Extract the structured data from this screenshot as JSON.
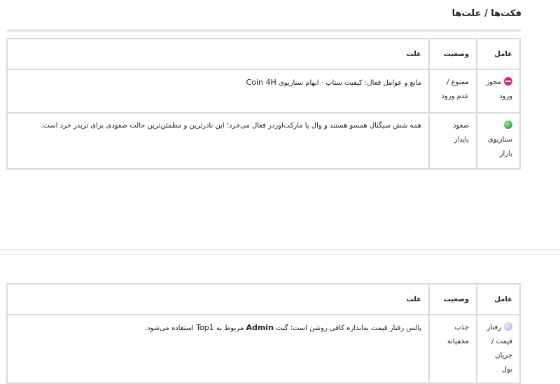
{
  "section": {
    "title": "فکت‌ها / علت‌ها"
  },
  "table1": {
    "headers": {
      "factor": "عامل",
      "status": "وضعیت",
      "reason": "علت"
    },
    "rows": [
      {
        "icon": "no-entry-icon",
        "factor": "مجوز ورود",
        "status": "ممنوع / عدم ورود",
        "reason_prefix": "مانع و عوامل فعال: کیفیت ستاپ · ابهام سناریوی",
        "reason_ltr": "Coin 4H"
      },
      {
        "icon": "green-circle-icon",
        "factor": "سناریوی بازار",
        "status": "صعود پایدار",
        "reason": "همه شش سیگنال همسو هستند و وال یا مارکت‌اوردر فعال می‌خرد؛ این نادرترین و مطمئن‌ترین حالت صعودی برای تریدر خرد است."
      }
    ]
  },
  "table2": {
    "headers": {
      "factor": "عامل",
      "status": "وضعیت",
      "reason": "علت"
    },
    "rows": [
      {
        "icon": "lavender-circle-icon",
        "factor": "رفتار قیمت / جریان پول",
        "status": "جذب مخفیانه",
        "reason_part1": "پالس رفتار قیمت به‌اندازه کافی روشن است؛ گیت",
        "reason_admin": "Admin",
        "reason_part2": "مربوط به",
        "reason_top1": "Top1",
        "reason_part3": "استفاده می‌شود."
      }
    ]
  },
  "colors": {
    "border": "#d3dbe3",
    "danger": "#e0245e",
    "success": "#2ea84a",
    "neutral": "#c4b3e6"
  }
}
